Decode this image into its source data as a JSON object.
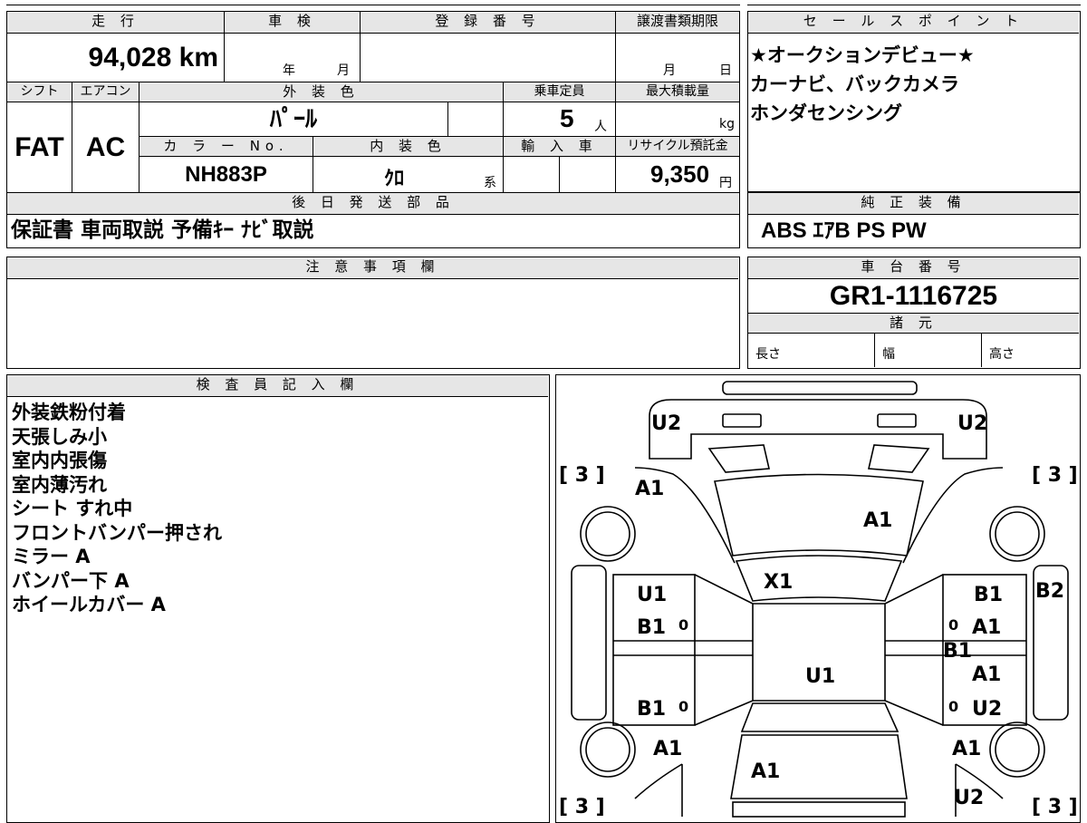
{
  "main": {
    "mileage_label": "走 行",
    "mileage_value": "94,028 km",
    "inspection_label": "車 検",
    "year_unit": "年",
    "month_unit": "月",
    "registration_label": "登 録 番 号",
    "transfer_label": "譲渡書類期限",
    "transfer_month": "月",
    "transfer_day": "日",
    "shift_label": "シフト",
    "shift_value": "FAT",
    "aircon_label": "エアコン",
    "aircon_value": "AC",
    "exterior_label": "外 装 色",
    "exterior_value": "ﾊﾟｰﾙ",
    "capacity_label": "乗車定員",
    "capacity_value": "5",
    "capacity_unit": "人",
    "maxload_label": "最大積載量",
    "maxload_unit": "kg",
    "color_no_label": "カ ラ ー No.",
    "color_no_value": "NH883P",
    "interior_label": "内 装 色",
    "interior_value": "ｸﾛ",
    "interior_suffix": "系",
    "import_label": "輸 入 車",
    "recycle_label": "リサイクル預託金",
    "recycle_value": "9,350",
    "recycle_unit": "円",
    "later_label": "後 日 発 送 部 品",
    "later_value": "保証書 車両取説 予備ｷｰ ﾅﾋﾞ取説"
  },
  "sales": {
    "label": "セ ー ル ス ポ イ ン ト",
    "lines": [
      "★オークションデビュー★",
      "カーナビ、バックカメラ",
      "ホンダセンシング"
    ]
  },
  "equipment": {
    "label": "純 正 装 備",
    "value": "ABS ｴｱB PS PW"
  },
  "notes": {
    "label": "注 意 事 項 欄"
  },
  "chassis": {
    "label": "車 台 番 号",
    "value": "GR1-1116725",
    "specs_label": "諸 元",
    "length_label": "長さ",
    "width_label": "幅",
    "height_label": "高さ"
  },
  "inspector": {
    "label": "検 査 員 記 入 欄",
    "items": [
      "外装鉄粉付着",
      "天張しみ小",
      "室内内張傷",
      "室内薄汚れ",
      "シート すれ中",
      "フロントバンパー押され",
      "ミラー A",
      "バンパー下 A",
      "ホイールカバー A"
    ]
  },
  "diagram": {
    "marks": {
      "u2_tl": "U2",
      "u2_tr": "U2",
      "bracket_tl": "[ 3 ]",
      "bracket_tr": "[ 3 ]",
      "bracket_bl": "[ 3 ]",
      "bracket_br": "[ 3 ]",
      "a1_fl": "A1",
      "a1_hood": "A1",
      "x1_windshield": "X1",
      "u1_left_front": "U1",
      "b1_left_front": "B1",
      "b1_left_rear": "B1",
      "b1_right_front": "B1",
      "a1_right_front": "A1",
      "b1_right_mid": "B1",
      "a1_right_mid": "A1",
      "u2_right_rear": "U2",
      "b2_right": "B2",
      "u1_roof": "U1",
      "a1_rl": "A1",
      "a1_rear": "A1",
      "a1_rr": "A1",
      "u2_br": "U2",
      "zero_l1": "0",
      "zero_l2": "0",
      "zero_r1": "0",
      "zero_r2": "0"
    }
  }
}
